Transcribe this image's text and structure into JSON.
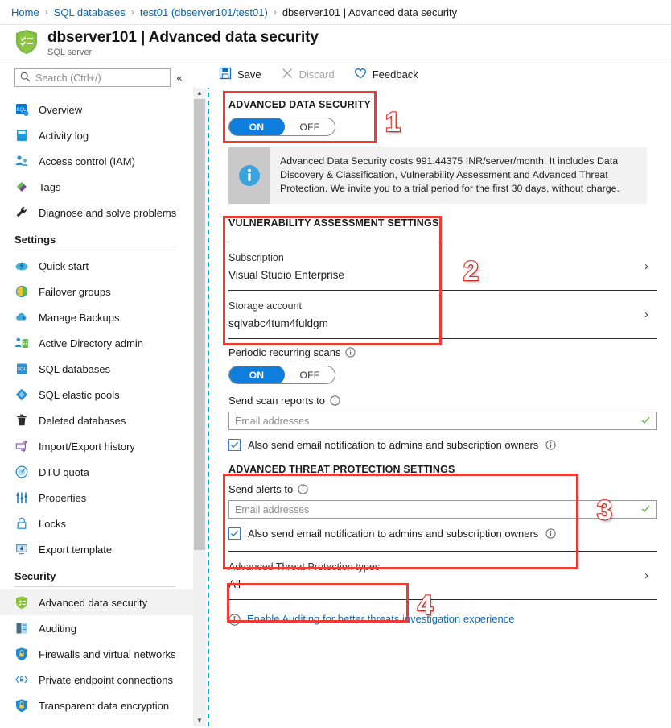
{
  "breadcrumb": {
    "items": [
      {
        "label": "Home",
        "link": true
      },
      {
        "label": "SQL databases",
        "link": true
      },
      {
        "label": "test01 (dbserver101/test01)",
        "link": true
      },
      {
        "label": "dbserver101 | Advanced data security",
        "link": false
      }
    ],
    "separator": "›"
  },
  "header": {
    "title": "dbserver101 | Advanced data security",
    "subtitle": "SQL server",
    "icon": "shield-checklist-icon"
  },
  "sidebar": {
    "search": {
      "placeholder": "Search (Ctrl+/)",
      "icon": "search-icon"
    },
    "collapse_icon": "«",
    "items": [
      {
        "label": "Overview",
        "icon": "sql-overview-icon",
        "selected": false
      },
      {
        "label": "Activity log",
        "icon": "activity-log-icon",
        "selected": false
      },
      {
        "label": "Access control (IAM)",
        "icon": "access-control-icon",
        "selected": false
      },
      {
        "label": "Tags",
        "icon": "tags-icon",
        "selected": false
      },
      {
        "label": "Diagnose and solve problems",
        "icon": "wrench-icon",
        "selected": false
      }
    ],
    "groups": [
      {
        "label": "Settings",
        "items": [
          {
            "label": "Quick start",
            "icon": "quick-start-icon",
            "selected": false
          },
          {
            "label": "Failover groups",
            "icon": "failover-groups-icon",
            "selected": false
          },
          {
            "label": "Manage Backups",
            "icon": "manage-backups-icon",
            "selected": false
          },
          {
            "label": "Active Directory admin",
            "icon": "active-directory-admin-icon",
            "selected": false
          },
          {
            "label": "SQL databases",
            "icon": "sql-database-icon",
            "selected": false
          },
          {
            "label": "SQL elastic pools",
            "icon": "elastic-pool-icon",
            "selected": false
          },
          {
            "label": "Deleted databases",
            "icon": "trash-icon",
            "selected": false
          },
          {
            "label": "Import/Export history",
            "icon": "import-export-icon",
            "selected": false
          },
          {
            "label": "DTU quota",
            "icon": "gauge-icon",
            "selected": false
          },
          {
            "label": "Properties",
            "icon": "sliders-icon",
            "selected": false
          },
          {
            "label": "Locks",
            "icon": "lock-icon",
            "selected": false
          },
          {
            "label": "Export template",
            "icon": "export-template-icon",
            "selected": false
          }
        ]
      },
      {
        "label": "Security",
        "items": [
          {
            "label": "Advanced data security",
            "icon": "shield-green-icon",
            "selected": true
          },
          {
            "label": "Auditing",
            "icon": "auditing-icon",
            "selected": false
          },
          {
            "label": "Firewalls and virtual networks",
            "icon": "shield-blue-icon",
            "selected": false
          },
          {
            "label": "Private endpoint connections",
            "icon": "private-endpoint-icon",
            "selected": false
          },
          {
            "label": "Transparent data encryption",
            "icon": "shield-blue-icon",
            "selected": false
          }
        ]
      }
    ]
  },
  "toolbar": {
    "save_label": "Save",
    "discard_label": "Discard",
    "feedback_label": "Feedback",
    "discard_disabled": true
  },
  "main": {
    "ads": {
      "title": "ADVANCED DATA SECURITY",
      "toggle": {
        "on_label": "ON",
        "off_label": "OFF",
        "state": "ON"
      }
    },
    "info_banner": {
      "icon": "info-icon",
      "text": "Advanced Data Security costs 991.44375 INR/server/month. It includes Data Discovery & Classification, Vulnerability Assessment and Advanced Threat Protection. We invite you to a trial period for the first 30 days, without charge."
    },
    "vulnerability": {
      "title": "VULNERABILITY ASSESSMENT SETTINGS",
      "rows": [
        {
          "label": "Subscription",
          "value": "Visual Studio Enterprise",
          "chevron": "›"
        },
        {
          "label": "Storage account",
          "value": "sqlvabc4tum4fuldgm",
          "chevron": "›"
        }
      ],
      "periodic_scans": {
        "label": "Periodic recurring scans",
        "info_icon": "info-outline-icon",
        "toggle": {
          "on_label": "ON",
          "off_label": "OFF",
          "state": "ON"
        }
      },
      "send_scan_reports": {
        "label": "Send scan reports to",
        "info_icon": "info-outline-icon",
        "placeholder": "Email addresses",
        "value": "",
        "valid_icon": "check-icon"
      },
      "also_send_email": {
        "label": "Also send email notification to admins and subscription owners",
        "checked": true,
        "info_icon": "info-outline-icon"
      }
    },
    "threat_protection": {
      "title": "ADVANCED THREAT PROTECTION SETTINGS",
      "send_alerts": {
        "label": "Send alerts to",
        "info_icon": "info-outline-icon",
        "placeholder": "Email addresses",
        "value": "",
        "valid_icon": "check-icon"
      },
      "also_send_email": {
        "label": "Also send email notification to admins and subscription owners",
        "checked": true,
        "info_icon": "info-outline-icon"
      },
      "types_row": {
        "label": "Advanced Threat Protection types",
        "value": "All",
        "chevron": "›"
      }
    },
    "auditing_link": {
      "icon": "info-outline-icon",
      "text": "Enable Auditing for better threats investigation experience"
    }
  },
  "annotations": {
    "color": "#ee3b33",
    "markers": [
      {
        "number": "1"
      },
      {
        "number": "2"
      },
      {
        "number": "3"
      },
      {
        "number": "4"
      }
    ]
  }
}
